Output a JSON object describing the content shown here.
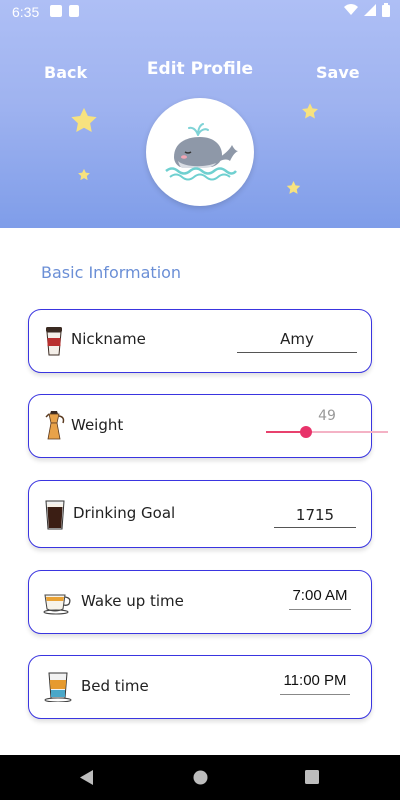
{
  "status_bar": {
    "time": "6:35"
  },
  "header": {
    "back_label": "Back",
    "title": "Edit Profile",
    "save_label": "Save"
  },
  "section": {
    "title": "Basic Information"
  },
  "fields": {
    "nickname": {
      "label": "Nickname",
      "value": "Amy"
    },
    "weight": {
      "label": "Weight",
      "value": "49",
      "slider_fraction": 0.33
    },
    "drinking_goal": {
      "label": "Drinking Goal",
      "value": "1715"
    },
    "wake_up_time": {
      "label": "Wake up time",
      "value": "7:00 AM"
    },
    "bed_time": {
      "label": "Bed time",
      "value": "11:00 PM"
    }
  },
  "colors": {
    "header_top": "#aebff5",
    "header_bottom": "#7f9de9",
    "card_border": "#3a35e0",
    "section_title": "#6b8fd6",
    "slider_accent": "#e8336a"
  },
  "icons": {
    "avatar": "whale-icon",
    "nickname": "coffee-cup-icon",
    "weight": "moka-pot-icon",
    "drinking_goal": "cola-glass-icon",
    "wake_up_time": "tea-cup-icon",
    "bed_time": "latte-glass-icon"
  }
}
